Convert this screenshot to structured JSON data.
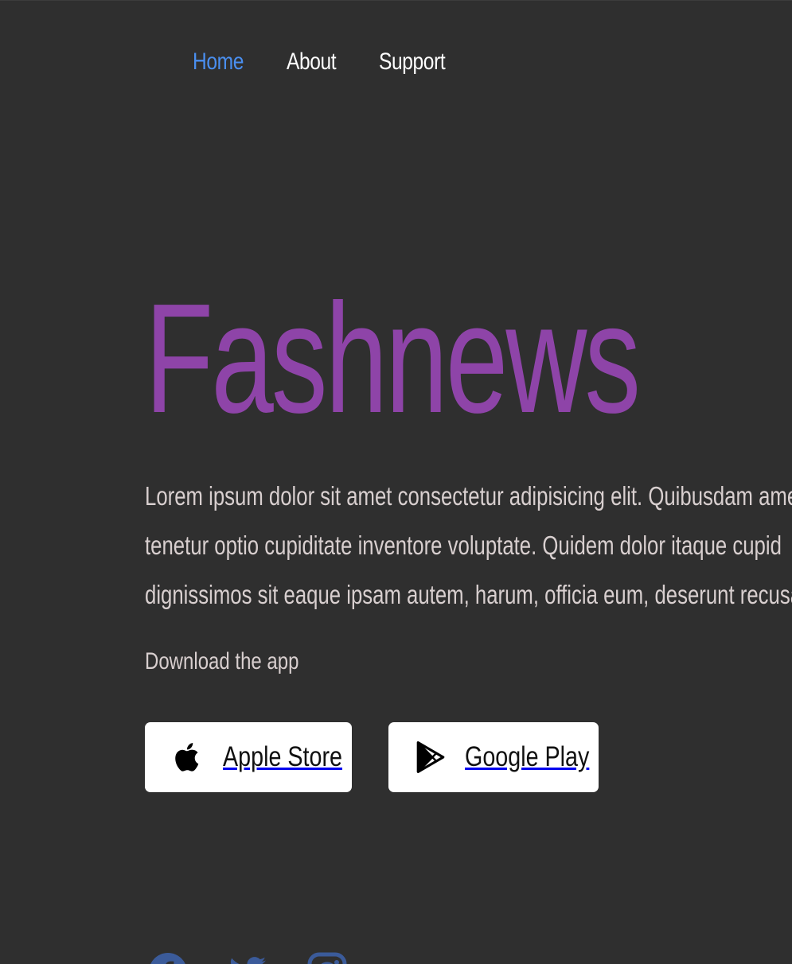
{
  "nav": {
    "items": [
      {
        "label": "Home",
        "active": true
      },
      {
        "label": "About",
        "active": false
      },
      {
        "label": "Support",
        "active": false
      }
    ]
  },
  "hero": {
    "title": "Fashnews",
    "paragraph_lines": [
      "Lorem ipsum dolor sit amet consectetur adipisicing elit. Quibusdam ame",
      "tenetur optio cupiditate inventore voluptate. Quidem dolor itaque cupid",
      "dignissimos sit eaque ipsam autem, harum, officia eum, deserunt recusa"
    ],
    "download_label": "Download the app"
  },
  "store_buttons": {
    "apple": {
      "label": "Apple Store",
      "icon": "apple-icon"
    },
    "google": {
      "label": "Google Play",
      "icon": "google-play-icon"
    }
  },
  "social": {
    "icons": [
      "facebook-icon",
      "twitter-icon",
      "instagram-icon"
    ]
  },
  "colors": {
    "background": "#2f2f2f",
    "accent_title": "#8e44a8",
    "nav_active": "#4a8ff0",
    "social": "#3b5b9a"
  }
}
